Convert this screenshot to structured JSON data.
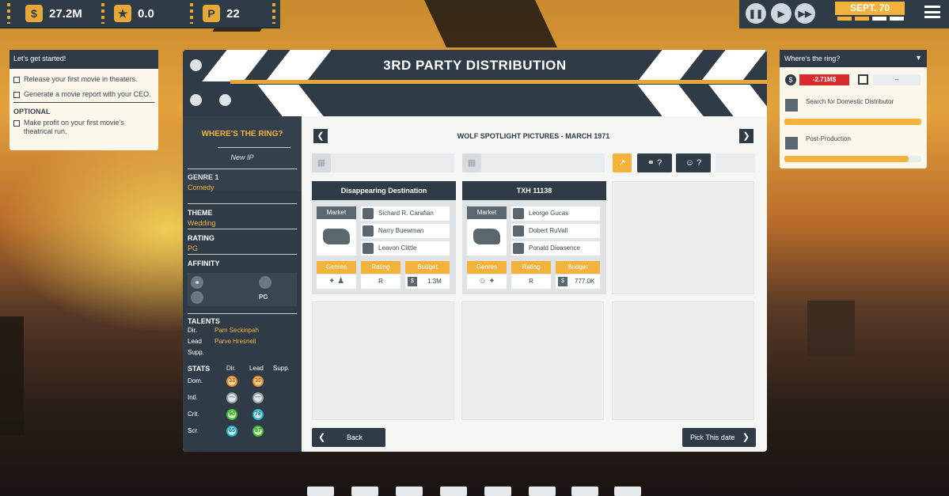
{
  "hud": {
    "money": "27.2M",
    "rating": "0.0",
    "points": "22",
    "date": "SEPT. 70"
  },
  "tutorial": {
    "title": "Let's get started!",
    "tasks": [
      "Release your first movie in theaters.",
      "Generate a movie report with your CEO."
    ],
    "optional_label": "OPTIONAL",
    "optional_tasks": [
      "Make profit on your first movie's theatrical run."
    ]
  },
  "dialog": {
    "title": "3RD PARTY DISTRIBUTION",
    "nav_title": "WOLF SPOTLIGHT PICTURES - MARCH 1971",
    "back_label": "Back",
    "pick_label": "Pick This date"
  },
  "movie": {
    "title": "WHERE'S THE RING?",
    "ip": "New IP",
    "genre_label": "GENRE 1",
    "genre": "Comedy",
    "theme_label": "THEME",
    "theme": "Wedding",
    "rating_label": "RATING",
    "rating": "PG",
    "affinity_label": "AFFINITY",
    "affinity_rating": "PG",
    "talents_label": "TALENTS",
    "talents": [
      {
        "role": "Dir.",
        "name": "Pam Seckinpah"
      },
      {
        "role": "Lead",
        "name": "Parve Hresnell"
      },
      {
        "role": "Supp.",
        "name": ""
      }
    ],
    "stats_label": "STATS",
    "stat_cols": [
      "Dir.",
      "Lead",
      "Supp."
    ],
    "stats": [
      {
        "label": "Dom.",
        "dir": "33",
        "lead": "35"
      },
      {
        "label": "Intl.",
        "dir": "—",
        "lead": "—"
      },
      {
        "label": "Crit.",
        "dir": "90",
        "lead": "78"
      },
      {
        "label": "Scr.",
        "dir": "65",
        "lead": "87"
      }
    ]
  },
  "cards": [
    {
      "title": "Disappearing Destination",
      "market": "Market",
      "people": [
        "Sichard R. Carafian",
        "Narry Buewman",
        "Leavon Clittle"
      ],
      "genres_label": "Genres",
      "rating_label": "Rating",
      "budget_label": "Budget",
      "rating": "R",
      "budget": "1.3M"
    },
    {
      "title": "TXH 11138",
      "market": "Market",
      "people": [
        "Leorge Gucas",
        "Dobert RuVall",
        "Ponald Dieasence"
      ],
      "genres_label": "Genres",
      "rating_label": "Rating",
      "budget_label": "Budget",
      "rating": "R",
      "budget": "777.0K"
    }
  ],
  "right_panel": {
    "title": "Where's the ring?",
    "cost": "-2.71M$",
    "date": "--",
    "tasks": [
      {
        "label": "Search for Domestic Distributor",
        "progress": 1.0
      },
      {
        "label": "Post-Production",
        "progress": 0.91
      }
    ]
  },
  "colors": {
    "accent": "#f2b23c",
    "panel": "#2f3c48",
    "red": "#d92b2b"
  }
}
